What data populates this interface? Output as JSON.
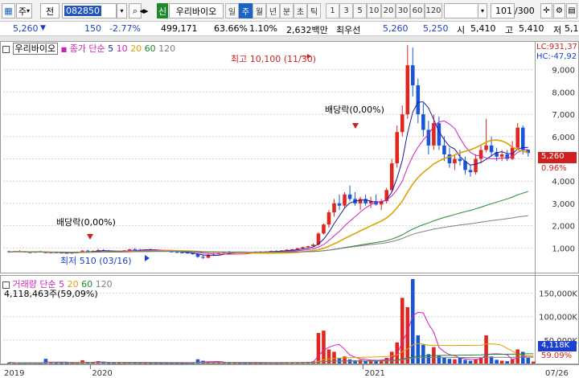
{
  "toolbar": {
    "market_select": "주",
    "prefix_label": "전",
    "code_value": "082850",
    "market_tag": "신",
    "stock_name": "우리바이오",
    "periods": [
      "일",
      "주",
      "월",
      "년",
      "분",
      "초",
      "틱"
    ],
    "active_period": "주",
    "intervals": [
      "1",
      "3",
      "5",
      "10",
      "20",
      "30",
      "60",
      "120"
    ],
    "count_value": "101",
    "count_total": "/300"
  },
  "quote": {
    "price": "5,260",
    "change": "150",
    "change_rate": "-2.77%",
    "volume": "499,171",
    "vol_ratio": "63.66%",
    "turnover": "1.10%",
    "amount": "2,632백만",
    "flag": "최우선",
    "ask": "5,260",
    "bid": "5,250",
    "open_label": "시",
    "open": "5,410",
    "high_label": "고",
    "high": "5,410",
    "low_label": "저",
    "low": "5,1"
  },
  "price_panel": {
    "title": "우리바이오",
    "ma_label": "종가 단순",
    "ma_periods": [
      "5",
      "10",
      "20",
      "60",
      "120"
    ],
    "ma_colors": [
      "#1a1aa0",
      "#d11fb8",
      "#e0a000",
      "#1e8a2e",
      "#808080"
    ],
    "lc": "LC:931,37",
    "hc": "HC:-47,92",
    "last_price": "5,260",
    "last_rate": "0.96%",
    "annotations": {
      "high": "최고 10,100 (11/30)",
      "low": "최저 510 (03/16)",
      "dividend_1": "배당락(0,00%)",
      "dividend_2": "배당락(0,00%)"
    }
  },
  "volume_panel": {
    "title": "거래량",
    "ma_label": "단순",
    "ma_periods": [
      "5",
      "20",
      "60",
      "120"
    ],
    "ma_colors": [
      "#d11fb8",
      "#e0a000",
      "#1e8a2e",
      "#808080"
    ],
    "summary": "4,118,463주(59,09%)",
    "last_value": "4,118K",
    "last_rate": "59.09%"
  },
  "chart_data": [
    {
      "type": "candlestick",
      "title": "우리바이오",
      "y_ticks": [
        "1,000",
        "2,000",
        "3,000",
        "4,000",
        "5,000",
        "6,000",
        "7,000",
        "8,000",
        "9,000"
      ],
      "ylim": [
        0,
        10000
      ],
      "x_ticks": [
        "2019",
        "2020",
        "2021",
        "07/26"
      ],
      "grid": true,
      "series": [
        {
          "name": "5",
          "color": "#1a1aa0"
        },
        {
          "name": "10",
          "color": "#d11fb8"
        },
        {
          "name": "20",
          "color": "#e0a000"
        },
        {
          "name": "60",
          "color": "#1e8a2e"
        },
        {
          "name": "120",
          "color": "#808080"
        }
      ],
      "points": [
        [
          850,
          880,
          780,
          820
        ],
        [
          820,
          870,
          800,
          850
        ],
        [
          850,
          900,
          820,
          830
        ],
        [
          830,
          860,
          790,
          810
        ],
        [
          810,
          840,
          760,
          790
        ],
        [
          790,
          850,
          770,
          840
        ],
        [
          840,
          880,
          800,
          810
        ],
        [
          810,
          830,
          760,
          770
        ],
        [
          770,
          820,
          750,
          800
        ],
        [
          800,
          840,
          780,
          790
        ],
        [
          790,
          830,
          760,
          780
        ],
        [
          780,
          810,
          740,
          760
        ],
        [
          760,
          800,
          730,
          790
        ],
        [
          790,
          830,
          770,
          810
        ],
        [
          810,
          900,
          790,
          880
        ],
        [
          880,
          920,
          840,
          850
        ],
        [
          850,
          890,
          820,
          870
        ],
        [
          870,
          960,
          850,
          900
        ],
        [
          900,
          940,
          860,
          880
        ],
        [
          880,
          910,
          840,
          850
        ],
        [
          850,
          880,
          800,
          820
        ],
        [
          820,
          860,
          790,
          840
        ],
        [
          840,
          900,
          820,
          890
        ],
        [
          890,
          960,
          870,
          940
        ],
        [
          940,
          1000,
          900,
          920
        ],
        [
          920,
          960,
          880,
          900
        ],
        [
          900,
          940,
          870,
          930
        ],
        [
          930,
          970,
          900,
          910
        ],
        [
          910,
          940,
          860,
          880
        ],
        [
          880,
          920,
          850,
          870
        ],
        [
          870,
          900,
          820,
          840
        ],
        [
          840,
          870,
          800,
          820
        ],
        [
          820,
          850,
          770,
          800
        ],
        [
          800,
          830,
          760,
          790
        ],
        [
          790,
          820,
          740,
          760
        ],
        [
          760,
          790,
          700,
          720
        ],
        [
          720,
          760,
          560,
          600
        ],
        [
          600,
          700,
          510,
          560
        ],
        [
          560,
          720,
          540,
          700
        ],
        [
          700,
          780,
          660,
          740
        ],
        [
          740,
          800,
          700,
          760
        ],
        [
          760,
          820,
          730,
          800
        ],
        [
          800,
          860,
          770,
          780
        ],
        [
          780,
          820,
          750,
          810
        ],
        [
          810,
          840,
          780,
          800
        ],
        [
          800,
          830,
          770,
          790
        ],
        [
          790,
          820,
          760,
          810
        ],
        [
          810,
          850,
          790,
          830
        ],
        [
          830,
          860,
          800,
          820
        ],
        [
          820,
          850,
          790,
          840
        ],
        [
          840,
          880,
          820,
          870
        ],
        [
          870,
          900,
          840,
          860
        ],
        [
          860,
          900,
          840,
          890
        ],
        [
          890,
          940,
          870,
          920
        ],
        [
          920,
          960,
          890,
          940
        ],
        [
          940,
          1000,
          920,
          990
        ],
        [
          990,
          1060,
          960,
          1040
        ],
        [
          1040,
          1100,
          1000,
          1080
        ],
        [
          1080,
          1200,
          1050,
          1150
        ],
        [
          1150,
          1700,
          1100,
          1650
        ],
        [
          1650,
          2100,
          1600,
          2050
        ],
        [
          2050,
          2700,
          1900,
          2600
        ],
        [
          2600,
          3200,
          2400,
          3000
        ],
        [
          3000,
          3400,
          2700,
          2900
        ],
        [
          2900,
          3500,
          2800,
          3400
        ],
        [
          3400,
          3800,
          3100,
          3200
        ],
        [
          3200,
          3500,
          2900,
          3000
        ],
        [
          3000,
          3300,
          2700,
          3200
        ],
        [
          3200,
          3400,
          2900,
          3000
        ],
        [
          3000,
          3300,
          2800,
          3100
        ],
        [
          3100,
          3400,
          2900,
          2950
        ],
        [
          2950,
          3200,
          2700,
          3100
        ],
        [
          3100,
          3700,
          3000,
          3600
        ],
        [
          3600,
          5000,
          3500,
          4800
        ],
        [
          4800,
          6500,
          4600,
          6200
        ],
        [
          6200,
          7400,
          6000,
          7000
        ],
        [
          7000,
          10100,
          6800,
          9200
        ],
        [
          9200,
          10000,
          7800,
          8300
        ],
        [
          8300,
          8600,
          6600,
          7000
        ],
        [
          7000,
          7500,
          6000,
          6300
        ],
        [
          6300,
          6700,
          5200,
          5600
        ],
        [
          5600,
          7000,
          5400,
          6600
        ],
        [
          6600,
          6900,
          5400,
          5600
        ],
        [
          5600,
          6000,
          4900,
          5200
        ],
        [
          5200,
          5500,
          4600,
          4800
        ],
        [
          4800,
          5200,
          4500,
          5000
        ],
        [
          5000,
          5400,
          4700,
          4900
        ],
        [
          4900,
          5100,
          4300,
          4500
        ],
        [
          4500,
          4700,
          4200,
          4400
        ],
        [
          4400,
          5200,
          4300,
          5000
        ],
        [
          5000,
          5600,
          4800,
          5400
        ],
        [
          5400,
          6800,
          5300,
          5600
        ],
        [
          5600,
          6000,
          5100,
          5300
        ],
        [
          5300,
          5500,
          4900,
          5100
        ],
        [
          5100,
          5400,
          4900,
          5200
        ],
        [
          5200,
          5400,
          4900,
          5000
        ],
        [
          5000,
          5800,
          4950,
          5500
        ],
        [
          5500,
          6600,
          5400,
          6400
        ],
        [
          6400,
          6500,
          5200,
          5410
        ],
        [
          5410,
          5410,
          5100,
          5260
        ]
      ]
    },
    {
      "type": "bar",
      "title": "거래량",
      "y_ticks": [
        "50,000K",
        "100,000K",
        "150,000K"
      ],
      "ylim": [
        0,
        180000
      ],
      "values": [
        2000,
        1500,
        1200,
        1000,
        1800,
        1300,
        1100,
        10000,
        1400,
        1200,
        1000,
        900,
        1300,
        1500,
        7000,
        2000,
        1600,
        5000,
        1800,
        1400,
        1200,
        1100,
        1500,
        2200,
        1800,
        1500,
        1300,
        1200,
        1100,
        1000,
        1000,
        900,
        900,
        800,
        900,
        1000,
        9000,
        6000,
        3000,
        2000,
        1800,
        1500,
        1200,
        1300,
        1100,
        1000,
        1100,
        1200,
        1100,
        1300,
        1500,
        1400,
        1600,
        2000,
        2200,
        2400,
        2600,
        3500,
        4500,
        65000,
        70000,
        30000,
        25000,
        12000,
        15000,
        9000,
        7000,
        8000,
        6000,
        7000,
        6000,
        8000,
        12000,
        25000,
        45000,
        140000,
        120000,
        180000,
        60000,
        40000,
        20000,
        35000,
        18000,
        12000,
        10000,
        9000,
        12000,
        8000,
        6000,
        9000,
        12000,
        60000,
        15000,
        8000,
        6000,
        5000,
        9000,
        30000,
        25000,
        12000,
        4118
      ],
      "series": [
        {
          "name": "5",
          "color": "#d11fb8"
        },
        {
          "name": "20",
          "color": "#e0a000"
        },
        {
          "name": "60",
          "color": "#1e8a2e"
        },
        {
          "name": "120",
          "color": "#808080"
        }
      ]
    }
  ]
}
